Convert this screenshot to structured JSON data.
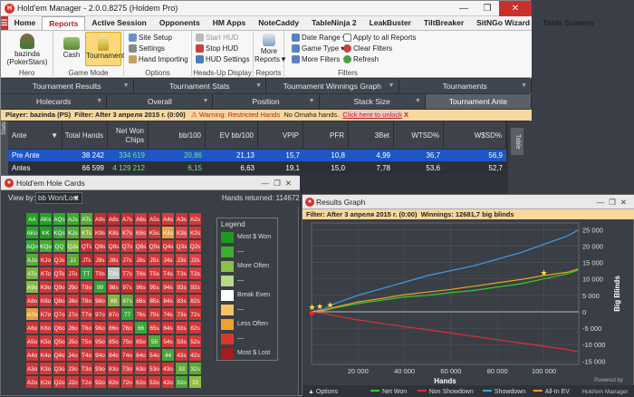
{
  "main_window": {
    "title": "Hold'em Manager - 2.0.0.8275 (Holdem Pro)",
    "app_icon": "H",
    "window_controls": [
      "—",
      "❐",
      "✕"
    ],
    "menu": [
      "Home",
      "Reports",
      "Active Session",
      "Opponents",
      "HM Apps",
      "NoteCaddy",
      "TableNinja 2",
      "LeakBuster",
      "TiltBreaker",
      "SitNGo Wizard",
      "Table Scanner"
    ],
    "menu_active": "Reports"
  },
  "ribbon": {
    "hero": {
      "name": "bazinda",
      "site": "(PokerStars)",
      "arrow": "▼",
      "label": "Hero"
    },
    "game_mode": {
      "cash": "Cash",
      "tournament": "Tournament",
      "label": "Game Mode"
    },
    "options": {
      "site_setup": "Site Setup",
      "settings": "Settings",
      "hand_importing": "Hand Importing",
      "label": "Options"
    },
    "hud": {
      "start": "Start HUD",
      "stop": "Stop HUD",
      "settings": "HUD Settings",
      "label": "Heads-Up Display"
    },
    "reports": {
      "more": "More",
      "reports": "Reports",
      "arrow": "▼",
      "label": "Reports"
    },
    "filters": {
      "date_range": "Date Range",
      "game_type": "Game Type",
      "more_filters": "More Filters",
      "apply_all": "Apply to all Reports",
      "clear": "Clear Filters",
      "refresh": "Refresh",
      "label": "Filters"
    }
  },
  "tabs_row1": [
    {
      "label": "Tournament Results",
      "arrow": "▼"
    },
    {
      "label": "Tournament Stats",
      "arrow": "▼"
    },
    {
      "label": "Tournament Winnings Graph",
      "arrow": "▼"
    },
    {
      "label": "Tournaments",
      "arrow": "▼"
    }
  ],
  "tabs_row2": [
    {
      "label": "Holecards",
      "arrow": "▼"
    },
    {
      "label": "Overall",
      "arrow": "▼"
    },
    {
      "label": "Position",
      "arrow": "▼"
    },
    {
      "label": "Stack Size",
      "arrow": "▼"
    },
    {
      "label": "Tournament Ante",
      "arrow": ""
    }
  ],
  "filterbar": {
    "player": "Player: bazinda (PS)",
    "filter": "Filter: After 3 апреля 2015 г. (0:00)",
    "warning": "Warning: Restricted Hands",
    "no_omaha": "No Omaha hands.",
    "unlock": "Click here to unlock",
    "close": "X"
  },
  "stats_sidebar": "Stats",
  "right_sidebar": "Table",
  "grid": {
    "headers": [
      "Ante",
      "Total Hands",
      "Net Won Chips",
      "bb/100",
      "EV bb/100",
      "VPIP",
      "PFR",
      "3Bet",
      "WTSD%",
      "W$SD%"
    ],
    "sort_icon": "▼",
    "rows": [
      [
        "Pre Ante",
        "38 242",
        "334 619",
        "20,86",
        "21,13",
        "15,7",
        "10,8",
        "4,99",
        "36,7",
        "56,9"
      ],
      [
        "Antes",
        "66 599",
        "4 129 212",
        "6,15",
        "6,63",
        "19,1",
        "15,0",
        "7,78",
        "53,6",
        "52,7"
      ]
    ]
  },
  "holecards": {
    "title": "Hold'em Hole Cards",
    "viewby_label": "View by:",
    "viewby_value": "bb Won/Lost",
    "viewby_arrow": "▼",
    "hands_returned_label": "Hands returned:",
    "hands_returned": "114672",
    "window_controls": [
      "—",
      "❐",
      "✕"
    ],
    "cells": [
      [
        "AA",
        "AKs",
        "AQs",
        "AJs",
        "ATs",
        "A9s",
        "A8s",
        "A7s",
        "A6s",
        "A5s",
        "A4s",
        "A3s",
        "A2s"
      ],
      [
        "AKo",
        "KK",
        "KQs",
        "KJs",
        "KTs",
        "K9s",
        "K8s",
        "K7s",
        "K6s",
        "K5s",
        "K4s",
        "K3s",
        "K2s"
      ],
      [
        "AQo",
        "KQo",
        "QQ",
        "QJs",
        "QTs",
        "Q9s",
        "Q8s",
        "Q7s",
        "Q6s",
        "Q5s",
        "Q4s",
        "Q3s",
        "Q2s"
      ],
      [
        "AJo",
        "KJo",
        "QJo",
        "JJ",
        "JTs",
        "J9s",
        "J8s",
        "J7s",
        "J6s",
        "J5s",
        "J4s",
        "J3s",
        "J2s"
      ],
      [
        "ATo",
        "KTo",
        "QTo",
        "JTo",
        "TT",
        "T9s",
        "T8s",
        "T7s",
        "T6s",
        "T5s",
        "T4s",
        "T3s",
        "T2s"
      ],
      [
        "A9o",
        "K9o",
        "Q9o",
        "J9o",
        "T9o",
        "99",
        "98s",
        "97s",
        "96s",
        "95s",
        "94s",
        "93s",
        "92s"
      ],
      [
        "A8o",
        "K8o",
        "Q8o",
        "J8o",
        "T8o",
        "98o",
        "88",
        "87s",
        "86s",
        "85s",
        "84s",
        "83s",
        "82s"
      ],
      [
        "A7o",
        "K7o",
        "Q7o",
        "J7o",
        "T7o",
        "97o",
        "87o",
        "77",
        "76s",
        "75s",
        "74s",
        "73s",
        "72s"
      ],
      [
        "A6o",
        "K6o",
        "Q6o",
        "J6o",
        "T6o",
        "96o",
        "86o",
        "76o",
        "66",
        "65s",
        "64s",
        "63s",
        "62s"
      ],
      [
        "A5o",
        "K5o",
        "Q5o",
        "J5o",
        "T5o",
        "95o",
        "85o",
        "75o",
        "65o",
        "55",
        "54s",
        "53s",
        "52s"
      ],
      [
        "A4o",
        "K4o",
        "Q4o",
        "J4o",
        "T4o",
        "94o",
        "84o",
        "74o",
        "64o",
        "54o",
        "44",
        "43s",
        "42s"
      ],
      [
        "A3o",
        "K3o",
        "Q3o",
        "J3o",
        "T3o",
        "93o",
        "83o",
        "73o",
        "63o",
        "53o",
        "43o",
        "33",
        "32s"
      ],
      [
        "A2o",
        "K2o",
        "Q2o",
        "J2o",
        "T2o",
        "92o",
        "82o",
        "72o",
        "62o",
        "52o",
        "42o",
        "32o",
        "22"
      ]
    ],
    "cell_colors": [
      [
        "#1fa51f",
        "#22a322",
        "#2fa82f",
        "#3aac2a",
        "#5aa93a",
        "#c22d2d",
        "#c23030",
        "#c63030",
        "#d23a3a",
        "#c22d2d",
        "#d43c3c",
        "#cc3535",
        "#d03838"
      ],
      [
        "#2aa52a",
        "#1fa01f",
        "#37a737",
        "#58ab3b",
        "#7cb33f",
        "#c93232",
        "#d03a3a",
        "#e04444",
        "#d83f3f",
        "#cf3737",
        "#e8a040",
        "#e24646",
        "#d43c3c"
      ],
      [
        "#38a538",
        "#4aaa3a",
        "#45a735",
        "#7dbb3f",
        "#c53030",
        "#d03737",
        "#c93232",
        "#d43b3b",
        "#d83e3e",
        "#d23b3b",
        "#cf3838",
        "#d23b3b",
        "#d83f3f"
      ],
      [
        "#5aa93a",
        "#c93232",
        "#cf3737",
        "#5aaa36",
        "#c02b2b",
        "#cf3737",
        "#d43c3c",
        "#cc3535",
        "#cc3434",
        "#d13939",
        "#d43c3c",
        "#d84040",
        "#da4141"
      ],
      [
        "#7bb63e",
        "#cc3434",
        "#d43c3c",
        "#c93232",
        "#3aa43a",
        "#c93232",
        "#c5c5c5",
        "#d03838",
        "#d53c3c",
        "#d23939",
        "#d23939",
        "#d03737",
        "#d63e3e"
      ],
      [
        "#8abd42",
        "#d03838",
        "#cf3737",
        "#d53c3c",
        "#d23939",
        "#3a9f2f",
        "#cd3535",
        "#c62f2f",
        "#cc3535",
        "#cf3737",
        "#d13939",
        "#d43c3c",
        "#d23939"
      ],
      [
        "#d03a3a",
        "#cf3737",
        "#d13838",
        "#d13939",
        "#cc3434",
        "#d53d3d",
        "#8ab33f",
        "#6aa238",
        "#d13939",
        "#d23a3a",
        "#d43c3c",
        "#cc3434",
        "#d43c3c"
      ],
      [
        "#e8a040",
        "#d23a3a",
        "#cf3737",
        "#d03838",
        "#d13838",
        "#c43232",
        "#cc3434",
        "#3da03a",
        "#cf3737",
        "#d23939",
        "#d03838",
        "#d23a3a",
        "#cc3434"
      ],
      [
        "#cf3737",
        "#d03838",
        "#d23939",
        "#d43c3c",
        "#d13939",
        "#d23a3a",
        "#cf3737",
        "#d53d3d",
        "#42a43a",
        "#cf3737",
        "#d03838",
        "#d13939",
        "#cf3737"
      ],
      [
        "#d23939",
        "#d03838",
        "#d13939",
        "#d23a3a",
        "#cc3434",
        "#d43c3c",
        "#d13838",
        "#d23939",
        "#cf3737",
        "#50a73a",
        "#d03838",
        "#cf3737",
        "#d23939"
      ],
      [
        "#d13939",
        "#cf3737",
        "#d43c3c",
        "#d03838",
        "#d23939",
        "#d13939",
        "#d43c3c",
        "#cc3434",
        "#d03838",
        "#cf3737",
        "#4aa43a",
        "#cf3737",
        "#d03838"
      ],
      [
        "#d03838",
        "#d23939",
        "#cf3737",
        "#d13939",
        "#d03838",
        "#d23a3a",
        "#cc3434",
        "#d43c3c",
        "#d13939",
        "#d03838",
        "#cf3737",
        "#60ab3a",
        "#5aa836"
      ],
      [
        "#cf3737",
        "#d03838",
        "#d23939",
        "#d13939",
        "#cc3434",
        "#d43c3c",
        "#d03838",
        "#d23939",
        "#cf3737",
        "#d13939",
        "#d03838",
        "#4aa43a",
        "#8fbf44"
      ]
    ],
    "legend": {
      "title": "Legend",
      "items": [
        {
          "label": "Most $ Won",
          "color": "#1f9a1f"
        },
        {
          "label": "—",
          "color": "#3fae2f"
        },
        {
          "label": "More Often",
          "color": "#8ac04a"
        },
        {
          "label": "—",
          "color": "#b8d88a"
        },
        {
          "label": "Break Even",
          "color": "#ffffff"
        },
        {
          "label": "—",
          "color": "#f5c266"
        },
        {
          "label": "Less Often",
          "color": "#f0a030"
        },
        {
          "label": "—",
          "color": "#d8382c"
        },
        {
          "label": "Most $ Lost",
          "color": "#a51c1c"
        }
      ]
    }
  },
  "results_graph": {
    "title": "Results Graph",
    "window_controls": [
      "—",
      "❐",
      "✕"
    ],
    "filter": "Filter: After 3 апреля 2015 г. (0:00)",
    "winnings": "Winnings: 12681,7 big blinds",
    "powered_by": "Powered by",
    "powered_brand": "Hold'em Manager",
    "options_label": "Options",
    "options_arrow": "▲",
    "colors": {
      "net_won": "#2fd02f",
      "non_showdown": "#e03030",
      "showdown": "#3aa0f0",
      "allin_ev": "#f0a020",
      "bg": "#3a3e45"
    }
  },
  "chart_data": {
    "type": "line",
    "title": "",
    "xlabel": "Hands",
    "ylabel": "Big Blinds",
    "xlim": [
      0,
      115000
    ],
    "ylim": [
      -16000,
      27000
    ],
    "x_ticks": [
      20000,
      40000,
      60000,
      80000,
      100000
    ],
    "x_tick_labels": [
      "20 000",
      "40 000",
      "60 000",
      "80 000",
      "100 000"
    ],
    "y_ticks": [
      25000,
      20000,
      15000,
      10000,
      5000,
      0,
      -5000,
      -10000,
      -15000
    ],
    "y_tick_labels": [
      "25 000",
      "20 000",
      "15 000",
      "10 000",
      "5 000",
      "0",
      "-5 000",
      "-10 000",
      "-15 000"
    ],
    "grid": true,
    "legend_position": "bottom",
    "series": [
      {
        "name": "Net Won",
        "color": "#2fd02f",
        "x": [
          0,
          5000,
          10000,
          20000,
          30000,
          40000,
          50000,
          60000,
          70000,
          80000,
          90000,
          100000,
          110000,
          114672
        ],
        "y": [
          0,
          300,
          1200,
          2500,
          3500,
          4500,
          5000,
          5800,
          6500,
          7500,
          8500,
          10000,
          11500,
          12682
        ]
      },
      {
        "name": "Non Showdown",
        "color": "#e03030",
        "x": [
          0,
          5000,
          10000,
          20000,
          30000,
          40000,
          50000,
          60000,
          70000,
          80000,
          90000,
          100000,
          110000,
          114672
        ],
        "y": [
          0,
          -500,
          -1200,
          -2500,
          -3500,
          -4500,
          -5500,
          -6500,
          -7500,
          -8500,
          -9500,
          -10500,
          -11500,
          -12200
        ]
      },
      {
        "name": "Showdown",
        "color": "#3aa0f0",
        "x": [
          0,
          5000,
          10000,
          20000,
          30000,
          40000,
          50000,
          60000,
          70000,
          80000,
          90000,
          100000,
          110000,
          114672
        ],
        "y": [
          0,
          800,
          2500,
          5000,
          7000,
          9000,
          11000,
          12500,
          14000,
          16000,
          18000,
          20500,
          23000,
          24800
        ]
      },
      {
        "name": "All-In EV",
        "color": "#f0a020",
        "x": [
          0,
          5000,
          10000,
          20000,
          30000,
          40000,
          50000,
          60000,
          70000,
          80000,
          90000,
          100000,
          110000,
          114672
        ],
        "y": [
          0,
          400,
          1400,
          3000,
          4000,
          5200,
          6000,
          6800,
          7800,
          8800,
          9800,
          11000,
          12000,
          13000
        ]
      }
    ],
    "markers": [
      {
        "x": 200,
        "y": 1300,
        "type": "star"
      },
      {
        "x": 3500,
        "y": 1700,
        "type": "star"
      },
      {
        "x": 8000,
        "y": 2000,
        "type": "star"
      },
      {
        "x": 100000,
        "y": 11800,
        "type": "star"
      },
      {
        "x": 0,
        "y": -500,
        "type": "dot"
      }
    ]
  }
}
